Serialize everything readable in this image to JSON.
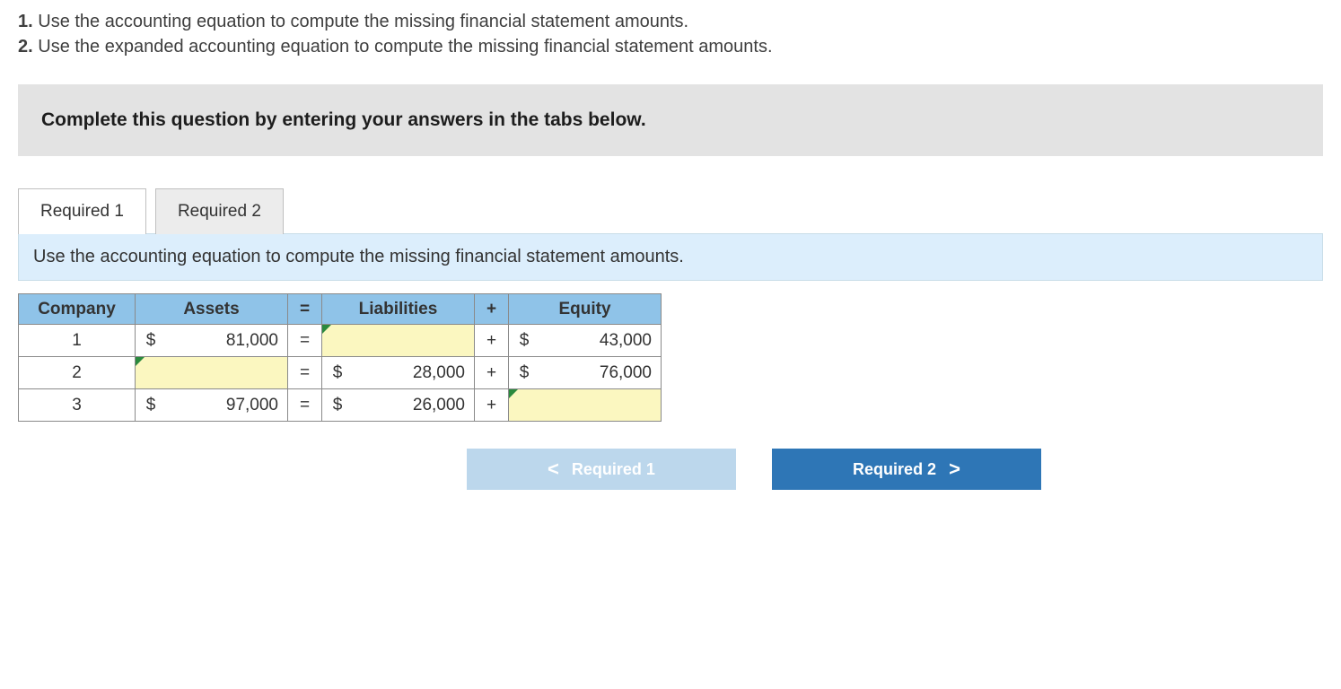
{
  "prompts": {
    "p1_num": "1.",
    "p1_text": " Use the accounting equation to compute the missing financial statement amounts.",
    "p2_num": "2.",
    "p2_text": " Use the expanded accounting equation to compute the missing financial statement amounts."
  },
  "banner": "Complete this question by entering your answers in the tabs below.",
  "tabs": {
    "t1": "Required 1",
    "t2": "Required 2"
  },
  "subprompt": "Use the accounting equation to compute the missing financial statement amounts.",
  "headers": {
    "company": "Company",
    "assets": "Assets",
    "eq": "=",
    "liabilities": "Liabilities",
    "plus": "+",
    "equity": "Equity"
  },
  "rows": [
    {
      "company": "1",
      "assets_sym": "$",
      "assets_val": "81,000",
      "eq": "=",
      "liab_sym": "",
      "liab_val": "",
      "plus": "+",
      "equity_sym": "$",
      "equity_val": "43,000",
      "input": "liab"
    },
    {
      "company": "2",
      "assets_sym": "",
      "assets_val": "",
      "eq": "=",
      "liab_sym": "$",
      "liab_val": "28,000",
      "plus": "+",
      "equity_sym": "$",
      "equity_val": "76,000",
      "input": "assets"
    },
    {
      "company": "3",
      "assets_sym": "$",
      "assets_val": "97,000",
      "eq": "=",
      "liab_sym": "$",
      "liab_val": "26,000",
      "plus": "+",
      "equity_sym": "",
      "equity_val": "",
      "input": "equity"
    }
  ],
  "nav": {
    "prev_chev": "<",
    "prev": "Required 1",
    "next": "Required 2",
    "next_chev": ">"
  },
  "chart_data": {
    "type": "table",
    "columns": [
      "Company",
      "Assets",
      "=",
      "Liabilities",
      "+",
      "Equity"
    ],
    "rows": [
      [
        "1",
        81000,
        "=",
        null,
        "+",
        43000
      ],
      [
        "2",
        null,
        "=",
        28000,
        "+",
        76000
      ],
      [
        "3",
        97000,
        "=",
        26000,
        "+",
        null
      ]
    ]
  }
}
